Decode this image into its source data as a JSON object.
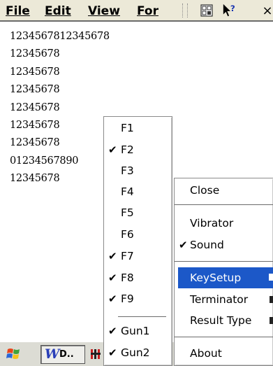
{
  "menubar": {
    "items": [
      {
        "label": "File"
      },
      {
        "label": "Edit"
      },
      {
        "label": "View"
      },
      {
        "label": "For"
      }
    ],
    "toolbar_icons": [
      "grid-tool-icon",
      "help-context-icon",
      "close-icon"
    ],
    "close_glyph": "×"
  },
  "document": {
    "lines": [
      "1234567812345678",
      "12345678",
      "12345678",
      "12345678",
      "12345678",
      "12345678",
      "12345678",
      "01234567890",
      "12345678"
    ]
  },
  "key_menu": {
    "items": [
      {
        "label": "F1",
        "checked": false
      },
      {
        "label": "F2",
        "checked": true
      },
      {
        "label": "F3",
        "checked": false
      },
      {
        "label": "F4",
        "checked": false
      },
      {
        "label": "F5",
        "checked": false
      },
      {
        "label": "F6",
        "checked": false
      },
      {
        "label": "F7",
        "checked": true
      },
      {
        "label": "F8",
        "checked": true
      },
      {
        "label": "F9",
        "checked": true
      },
      {
        "label": "Gun1",
        "checked": true
      },
      {
        "label": "Gun2",
        "checked": true
      }
    ],
    "check_glyph": "✔"
  },
  "main_menu": {
    "items": [
      {
        "label": "Close"
      },
      {
        "label": "Vibrator"
      },
      {
        "label": "Sound",
        "checked": true
      },
      {
        "label": "KeySetup",
        "highlighted": true
      },
      {
        "label": "Terminator"
      },
      {
        "label": "Result Type"
      },
      {
        "label": "About"
      }
    ]
  },
  "taskbar": {
    "task_label": "D..",
    "task_logo": "W"
  },
  "colors": {
    "highlight": "#1c58c8",
    "menubar_bg": "#ece9d8"
  }
}
